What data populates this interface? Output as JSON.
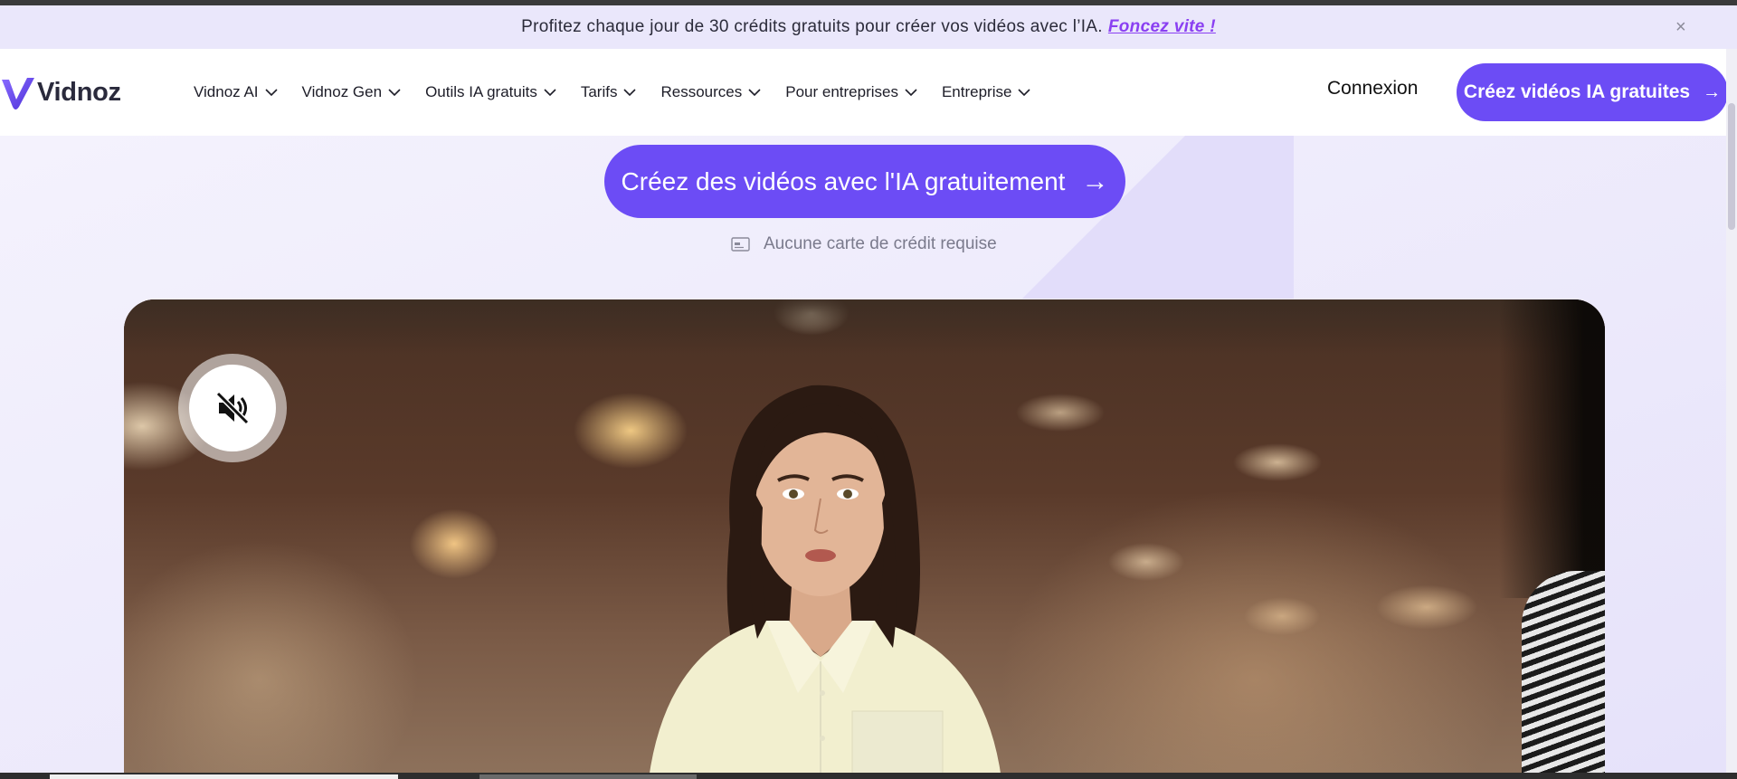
{
  "promo": {
    "text": "Profitez chaque jour de 30 crédits gratuits pour créer vos vidéos avec l’IA.",
    "link": "Foncez vite !",
    "close": "×"
  },
  "brand": {
    "name": "Vidnoz",
    "color": "#6c4cf5"
  },
  "nav": {
    "items": [
      {
        "label": "Vidnoz AI"
      },
      {
        "label": "Vidnoz Gen"
      },
      {
        "label": "Outils IA gratuits"
      },
      {
        "label": "Tarifs"
      },
      {
        "label": "Ressources"
      },
      {
        "label": "Pour entreprises"
      },
      {
        "label": "Entreprise"
      }
    ],
    "login": "Connexion",
    "cta": "Créez vidéos IA gratuites",
    "cta_arrow": "→"
  },
  "hero": {
    "cta": "Créez des vidéos avec l'IA gratuitement",
    "cta_arrow": "→",
    "note": "Aucune carte de crédit requise",
    "note_icon": "credit-card-icon"
  },
  "video": {
    "mute_icon": "speaker-muted-icon",
    "muted": true
  }
}
